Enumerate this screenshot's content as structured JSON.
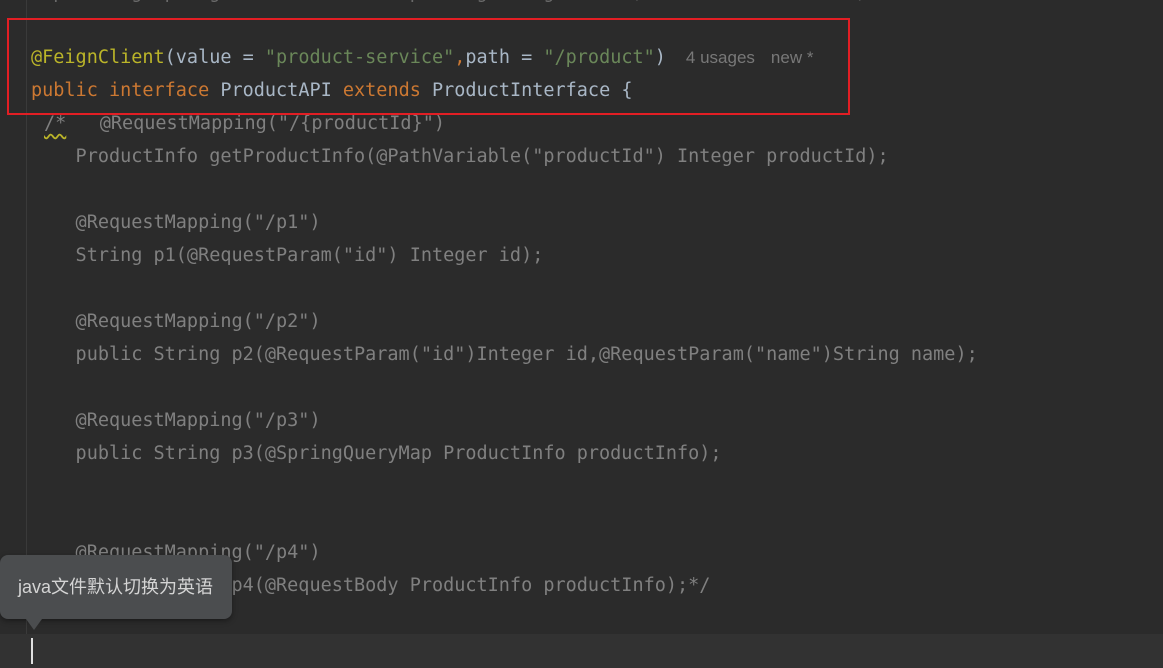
{
  "editor": {
    "line_cut": "import org.springframework.cloud.openfeign.FeignClient;                   ;",
    "l1": {
      "annotation": "@FeignClient",
      "open": "(value = ",
      "value_str": "\"product-service\"",
      "comma": ",",
      "path_key": "path = ",
      "path_str": "\"/product\"",
      "close": ")",
      "usages_hint": "4 usages",
      "new_hint": "new *"
    },
    "l2": {
      "kw_public": "public",
      "kw_interface": "interface",
      "name": "ProductAPI",
      "kw_extends": "extends",
      "parent": "ProductInterface {"
    },
    "l3": {
      "comment_start": "/*",
      "rest": "   @RequestMapping(\"/{productId}\")"
    },
    "l4": "    ProductInfo getProductInfo(@PathVariable(\"productId\") Integer productId);",
    "l5": "    @RequestMapping(\"/p1\")",
    "l6": "    String p1(@RequestParam(\"id\") Integer id);",
    "l7": "    @RequestMapping(\"/p2\")",
    "l8": "    public String p2(@RequestParam(\"id\")Integer id,@RequestParam(\"name\")String name);",
    "l9": "    @RequestMapping(\"/p3\")",
    "l10": "    public String p3(@SpringQueryMap ProductInfo productInfo);",
    "l11": "    @RequestMapping(\"/p4\")",
    "l12": "    public String p4(@RequestBody ProductInfo productInfo);*/"
  },
  "tooltip": {
    "text": "java文件默认切换为英语"
  },
  "colors": {
    "background": "#2b2b2b",
    "annotation": "#bbb529",
    "string": "#6a8759",
    "keyword": "#cc7832",
    "identifier": "#a9b7c6",
    "comment": "#808080",
    "highlight_box": "#e21e24"
  }
}
